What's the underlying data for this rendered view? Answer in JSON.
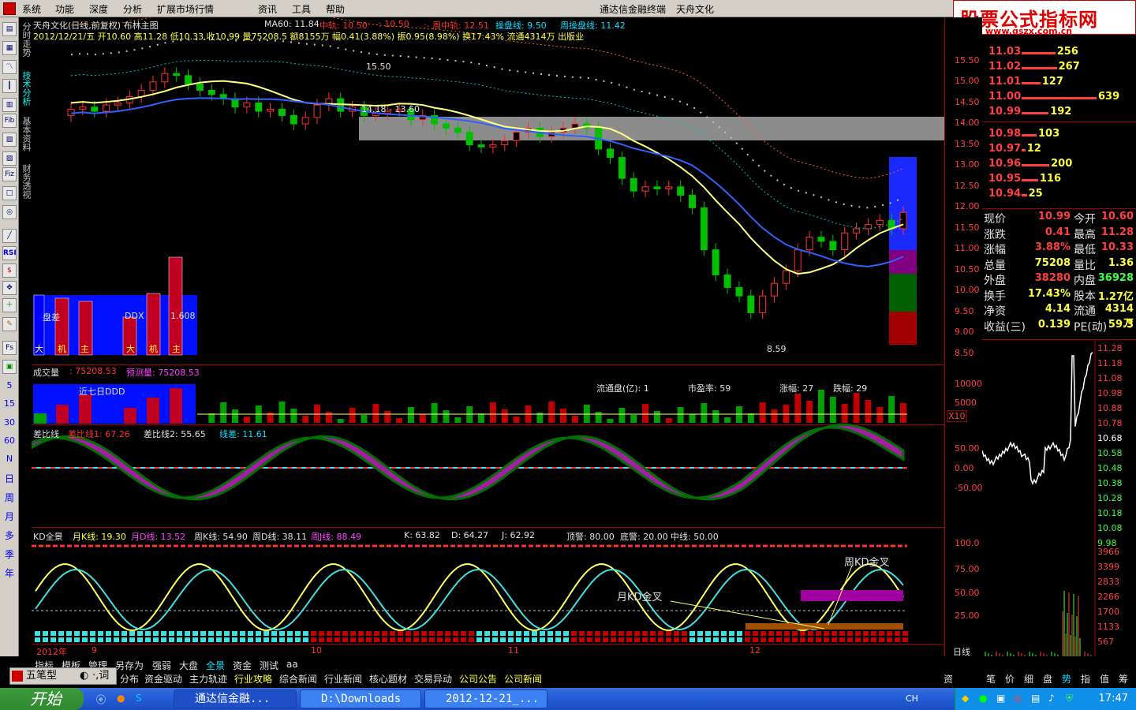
{
  "menu": [
    "系统",
    "功能",
    "深度",
    "分析",
    "扩展市场行情",
    "资讯",
    "工具",
    "帮助"
  ],
  "window_title": "通达信金融终端",
  "stock_title": "天舟文化",
  "watermark": {
    "line1": "股票公式指标网",
    "line2": "www.gszx.com.cn"
  },
  "vertical_tabs": [
    "分时走势",
    "技术分析",
    "基本资料",
    "财务透视"
  ],
  "left_toolbar": [
    "Fib",
    "Fiz",
    "RSI"
  ],
  "left_periods": [
    "5",
    "15",
    "30",
    "60",
    "N",
    "日",
    "周",
    "月",
    "多",
    "季",
    "年"
  ],
  "main": {
    "title": "天舟文化(日线,前复权) 布林主图",
    "ma60": "MA60: 11.84",
    "zhonggui": "中轨: 10.50",
    "zhonggui2": ": 10.50",
    "zhouzhonggui": ":- 周中轨: 12.51",
    "caopan": "操盘线: 9.50",
    "zhoucaopan": "周操盘线: 11.42",
    "ohlc": "2012/12/21/五 开10.60 高11.28 低10.33 收10.99 量75208.5 额8155万 幅0.41(3.88%) 振0.95(8.98%) 换17.43% 流通4314万 出版业",
    "ann_high": "15.50",
    "ann_range": "14.18 - 13.60",
    "ann_low": "8.59",
    "ddx_labels": [
      "盘差",
      "DDX",
      "1.608"
    ],
    "ddx_cats": [
      "大",
      "机",
      "主",
      "大",
      "机",
      "主"
    ]
  },
  "volume": {
    "title": "成交量",
    "val": ": 75208.53",
    "pred": "预测量: 75208.53",
    "ddd": "近七日DDD",
    "info": [
      "流通盘(亿):  1",
      "市盈率:  59",
      "涨幅:  27",
      "跌幅:  29"
    ],
    "x10": "X10"
  },
  "diff": {
    "title": "差比线",
    "l1": "差比线1: 67.26",
    "l2": "差比线2: 55.65",
    "l3": "线差: 11.61"
  },
  "kd": {
    "title": "KD全景",
    "mk": "月K线: 19.30",
    "md": "月D线: 13.52",
    "wk": "周K线: 54.90",
    "wd": "周D线: 38.11",
    "wj": "周J线: 88.49",
    "k": "K: 63.82",
    "d": "D: 64.27",
    "j": "J: 62.92",
    "top": "顶警: 80.00",
    "bot": "底警: 20.00",
    "mid": "中线: 50.00",
    "ann_month": "月KD金叉",
    "ann_week": "周KD金叉"
  },
  "xaxis": [
    "2012年",
    "9",
    "10",
    "11",
    "12"
  ],
  "yaxis_main": [
    "15.50",
    "15.00",
    "14.50",
    "14.00",
    "13.50",
    "13.00",
    "12.50",
    "12.00",
    "11.50",
    "11.00",
    "10.50",
    "10.00",
    "9.50",
    "9.00",
    "8.50"
  ],
  "yaxis_vol": [
    "10000",
    "5000"
  ],
  "yaxis_diff": [
    "50.00",
    "0.00",
    "-50.00"
  ],
  "yaxis_kd": [
    "100.0",
    "75.00",
    "50.00",
    "25.00"
  ],
  "orderbook": {
    "sell": [
      {
        "p": "11.03",
        "v": "256",
        "w": 0.45
      },
      {
        "p": "11.02",
        "v": "267",
        "w": 0.47
      },
      {
        "p": "11.01",
        "v": "127",
        "w": 0.25
      },
      {
        "p": "11.00",
        "v": "639",
        "w": 1.0
      },
      {
        "p": "10.99",
        "v": "192",
        "w": 0.36
      }
    ],
    "buy": [
      {
        "p": "10.98",
        "v": "103",
        "w": 0.2
      },
      {
        "p": "10.97",
        "v": "12",
        "w": 0.05
      },
      {
        "p": "10.96",
        "v": "200",
        "w": 0.37
      },
      {
        "p": "10.95",
        "v": "116",
        "w": 0.22
      },
      {
        "p": "10.94",
        "v": "25",
        "w": 0.07
      }
    ]
  },
  "quote": [
    [
      "现价",
      "10.99",
      "今开",
      "10.60"
    ],
    [
      "涨跌",
      "0.41",
      "最高",
      "11.28"
    ],
    [
      "涨幅",
      "3.88%",
      "最低",
      "10.33"
    ],
    [
      "总量",
      "75208",
      "量比",
      "1.36"
    ],
    [
      "外盘",
      "38280",
      "内盘",
      "36928"
    ],
    [
      "换手",
      "17.43%",
      "股本",
      "1.27亿"
    ],
    [
      "净资",
      "4.14",
      "流通",
      "4314万"
    ],
    [
      "收益(三)",
      "0.139",
      "PE(动)",
      "59.3"
    ]
  ],
  "mini_yaxis": [
    "11.28",
    "11.18",
    "11.08",
    "10.98",
    "10.88",
    "10.78",
    "10.68",
    "10.58",
    "10.48",
    "10.38",
    "10.28",
    "10.18",
    "10.08",
    "9.98",
    "3966",
    "3399",
    "2833",
    "2266",
    "1700",
    "1133",
    "567"
  ],
  "tabs_row1": [
    "指标",
    "模板",
    "管理",
    "另存为",
    "强弱",
    "大盘",
    "全景",
    "资金",
    "测试",
    "aa"
  ],
  "tabs_row2": [
    "分布",
    "资金驱动",
    "主力轨迹",
    "行业攻略",
    "综合新闻",
    "行业新闻",
    "核心题材",
    "交易异动",
    "公司公告",
    "公司新闻"
  ],
  "right_tabs": [
    "笔",
    "价",
    "细",
    "盘",
    "势",
    "指",
    "值",
    "筹"
  ],
  "ime": "五笔型",
  "ime_tail": "·,词",
  "daily_label": "日线",
  "plus_zero": "+",
  "zero": "0",
  "zi": "资",
  "taskbar": {
    "start": "开始",
    "b1": "通达信金融...",
    "b2": "D:\\Downloads",
    "b3": "2012-12-21_...",
    "clock": "17:47",
    "ch": "CH"
  }
}
